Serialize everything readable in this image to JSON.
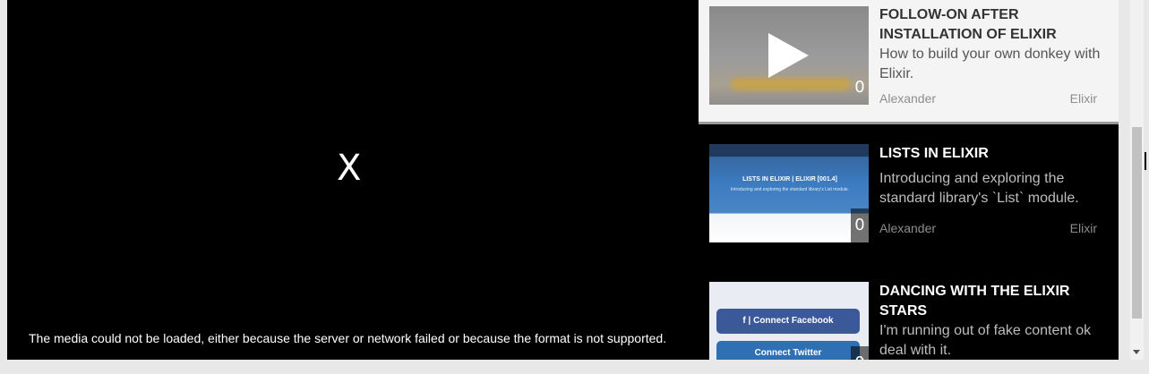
{
  "player": {
    "close_label": "X",
    "error_message": "The media could not be loaded, either because the server or network failed or because the format is not supported."
  },
  "videos": [
    {
      "title": "FOLLOW-ON AFTER INSTALLATION OF ELIXIR",
      "description": "How to build your own donkey with Elixir.",
      "author": "Alexander",
      "category": "Elixir",
      "count": "0",
      "icon": "play-icon"
    },
    {
      "title": "LISTS IN ELIXIR",
      "description": "Introducing and exploring the standard library's `List` module.",
      "author": "Alexander",
      "category": "Elixir",
      "count": "0",
      "thumb_title": "LISTS IN ELIXIR | ELIXIR [001.4]",
      "thumb_sub": "Introducing and exploring the standard library's List module."
    },
    {
      "title": "DANCING WITH THE ELIXIR STARS",
      "description": "I'm running out of fake content ok deal with it.",
      "count": "0",
      "thumb_fb": "f  |  Connect Facebook",
      "thumb_tw": "Connect Twitter"
    }
  ]
}
